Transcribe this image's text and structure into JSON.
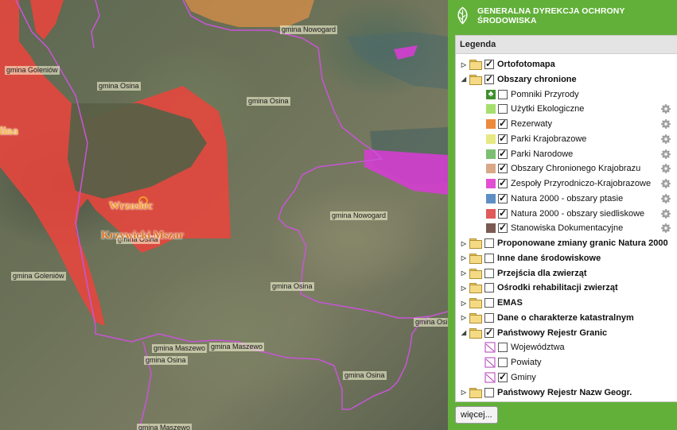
{
  "header": {
    "title": "GENERALNA DYREKCJA OCHRONY ŚRODOWISKA"
  },
  "legend": {
    "title": "Legenda",
    "more_button": "więcej..."
  },
  "layers": [
    {
      "label": "Ortofotomapa",
      "level": 0,
      "bold": true,
      "arrow": "▷",
      "checked": true,
      "gear": false
    },
    {
      "label": "Obszary chronione",
      "level": 0,
      "bold": true,
      "arrow": "◢",
      "checked": true,
      "gear": false
    },
    {
      "label": "Pomniki Przyrody",
      "level": 1,
      "swatch": "tree-icon",
      "checked": false,
      "gear": false
    },
    {
      "label": "Użytki Ekologiczne",
      "level": 1,
      "swatch": "#a6df6e",
      "checked": false,
      "gear": true
    },
    {
      "label": "Rezerwaty",
      "level": 1,
      "swatch": "#ee8a3c",
      "checked": true,
      "gear": true
    },
    {
      "label": "Parki Krajobrazowe",
      "level": 1,
      "swatch": "#e8e884",
      "checked": true,
      "gear": true
    },
    {
      "label": "Parki Narodowe",
      "level": 1,
      "swatch": "#7cbf72",
      "checked": true,
      "gear": true
    },
    {
      "label": "Obszary Chronionego Krajobrazu",
      "level": 1,
      "swatch": "#d9a888",
      "checked": true,
      "gear": true
    },
    {
      "label": "Zespoły Przyrodniczo-Krajobrazowe",
      "level": 1,
      "swatch": "#e24fd2",
      "checked": true,
      "gear": true
    },
    {
      "label": "Natura 2000 - obszary ptasie",
      "level": 1,
      "swatch": "#5e8fc4",
      "checked": true,
      "gear": true
    },
    {
      "label": "Natura 2000 - obszary siedliskowe",
      "level": 1,
      "swatch": "#e05a5a",
      "checked": true,
      "gear": true
    },
    {
      "label": "Stanowiska Dokumentacyjne",
      "level": 1,
      "swatch": "#7a5a52",
      "checked": true,
      "gear": true
    },
    {
      "label": "Proponowane zmiany granic Natura 2000",
      "level": 0,
      "bold": true,
      "arrow": "▷",
      "checked": false,
      "gear": false
    },
    {
      "label": "Inne dane środowiskowe",
      "level": 0,
      "bold": true,
      "arrow": "▷",
      "checked": false,
      "gear": false
    },
    {
      "label": "Przejścia dla zwierząt",
      "level": 0,
      "bold": true,
      "arrow": "▷",
      "checked": false,
      "gear": false
    },
    {
      "label": "Ośrodki rehabilitacji zwierząt",
      "level": 0,
      "bold": true,
      "arrow": "▷",
      "checked": false,
      "gear": false
    },
    {
      "label": "EMAS",
      "level": 0,
      "bold": true,
      "arrow": "▷",
      "checked": false,
      "gear": false
    },
    {
      "label": "Dane o charakterze katastralnym",
      "level": 0,
      "bold": true,
      "arrow": "▷",
      "checked": false,
      "gear": false
    },
    {
      "label": "Państwowy Rejestr Granic",
      "level": 0,
      "bold": true,
      "arrow": "◢",
      "checked": true,
      "gear": false
    },
    {
      "label": "Województwa",
      "level": 1,
      "swatch": "boundary-icon",
      "checked": false,
      "gear": false
    },
    {
      "label": "Powiaty",
      "level": 1,
      "swatch": "boundary-icon",
      "checked": false,
      "gear": false
    },
    {
      "label": "Gminy",
      "level": 1,
      "swatch": "boundary-icon",
      "checked": true,
      "gear": false
    },
    {
      "label": "Państwowy Rejestr Nazw Geogr.",
      "level": 0,
      "bold": true,
      "arrow": "▷",
      "checked": false,
      "gear": false
    }
  ],
  "map": {
    "labels": [
      "gmina Nowogard",
      "gmina Goleniów",
      "gmina Osina",
      "gmina Osina",
      "gmina Nowogard",
      "gmina Osina",
      "gmina Goleniów",
      "gmina Osina",
      "gmina Osina",
      "gmina Maszewo",
      "gmina Maszewo",
      "gmina Osina",
      "gmina Osina",
      "gmina Maszewo"
    ],
    "places": [
      "Wrzosiec",
      "Krzywicki Mszar",
      "lina"
    ]
  },
  "colors": {
    "sidebar_green": "#62b03a",
    "natura_red": "#e8463c",
    "zpk_magenta": "#d43ed0",
    "gmina_border": "#c855d8"
  }
}
